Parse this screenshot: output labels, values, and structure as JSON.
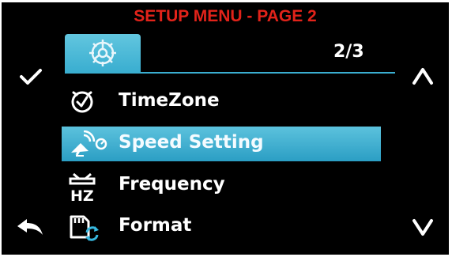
{
  "header": {
    "title": "SETUP MENU - PAGE 2",
    "page_indicator": "2/3"
  },
  "tab": {
    "icon": "settings-gear-icon"
  },
  "side_controls": {
    "left_top": "checkmark-icon",
    "left_bottom": "back-arrow-icon",
    "right_top": "up-arrow-icon",
    "right_bottom": "down-arrow-icon"
  },
  "menu": {
    "items": [
      {
        "label": "TimeZone",
        "icon": "clock-icon",
        "selected": false
      },
      {
        "label": "Speed Setting",
        "icon": "satellite-speed-icon",
        "selected": true
      },
      {
        "label": "Frequency",
        "icon": "hz-frequency-icon",
        "selected": false
      },
      {
        "label": "Format",
        "icon": "sd-card-format-icon",
        "selected": false
      }
    ]
  },
  "colors": {
    "title_red": "#e2231a",
    "accent_blue": "#3aaed0",
    "background": "#000000",
    "text": "#ffffff"
  }
}
